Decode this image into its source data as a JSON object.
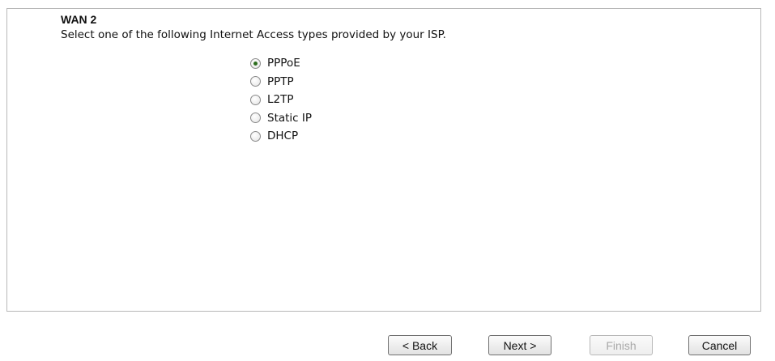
{
  "wan": {
    "title": "WAN 2",
    "instruction": "Select one of the following Internet Access types provided by your ISP."
  },
  "access_types": [
    {
      "label": "PPPoE",
      "checked": true
    },
    {
      "label": "PPTP",
      "checked": false
    },
    {
      "label": "L2TP",
      "checked": false
    },
    {
      "label": "Static IP",
      "checked": false
    },
    {
      "label": "DHCP",
      "checked": false
    }
  ],
  "buttons": {
    "back": "< Back",
    "next": "Next >",
    "finish": "Finish",
    "cancel": "Cancel"
  }
}
